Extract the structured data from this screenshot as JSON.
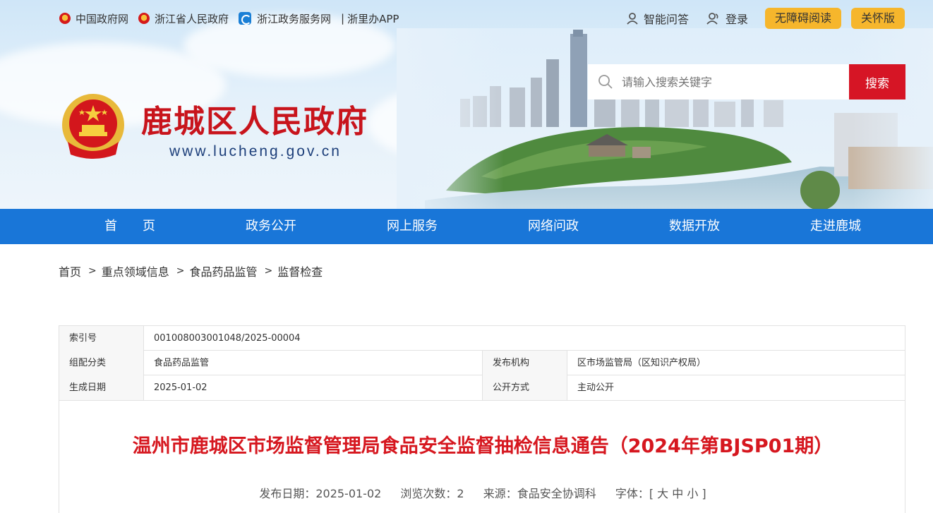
{
  "top_links": [
    {
      "label": "中国政府网",
      "icon": "national-emblem-icon"
    },
    {
      "label": "浙江省人民政府",
      "icon": "national-emblem-icon"
    },
    {
      "label": "浙江政务服务网",
      "icon": "zj-service-icon"
    },
    {
      "label": "浙里办APP"
    }
  ],
  "top_links_separator": "|",
  "top_right": {
    "smart_qa": "智能问答",
    "login": "登录",
    "accessible": "无障碍阅读",
    "care_mode": "关怀版"
  },
  "search": {
    "placeholder": "请输入搜索关键字",
    "button": "搜索"
  },
  "site": {
    "title": "鹿城区人民政府",
    "url": "www.lucheng.gov.cn"
  },
  "nav": [
    "首　　页",
    "政务公开",
    "网上服务",
    "网络问政",
    "数据开放",
    "走进鹿城"
  ],
  "breadcrumb": [
    "首页",
    "重点领域信息",
    "食品药品监管",
    "监督检查"
  ],
  "breadcrumb_sep": ">",
  "info": {
    "index_label": "索引号",
    "index_value": "001008003001048/2025-00004",
    "category_label": "组配分类",
    "category_value": "食品药品监管",
    "publisher_label": "发布机构",
    "publisher_value": "区市场监管局（区知识产权局）",
    "date_label": "生成日期",
    "date_value": "2025-01-02",
    "mode_label": "公开方式",
    "mode_value": "主动公开"
  },
  "article": {
    "title": "温州市鹿城区市场监督管理局食品安全监督抽检信息通告（2024年第BJSP01期）",
    "publish_date": "发布日期：2025-01-02",
    "views": "浏览次数：2",
    "source": "来源：食品安全协调科",
    "font_size_label": "字体：[ 大 中 小 ]"
  },
  "colors": {
    "brand_red": "#d61525",
    "nav_blue": "#1976d8",
    "pill_yellow": "#f6b62c",
    "title_red": "#c8141c"
  }
}
